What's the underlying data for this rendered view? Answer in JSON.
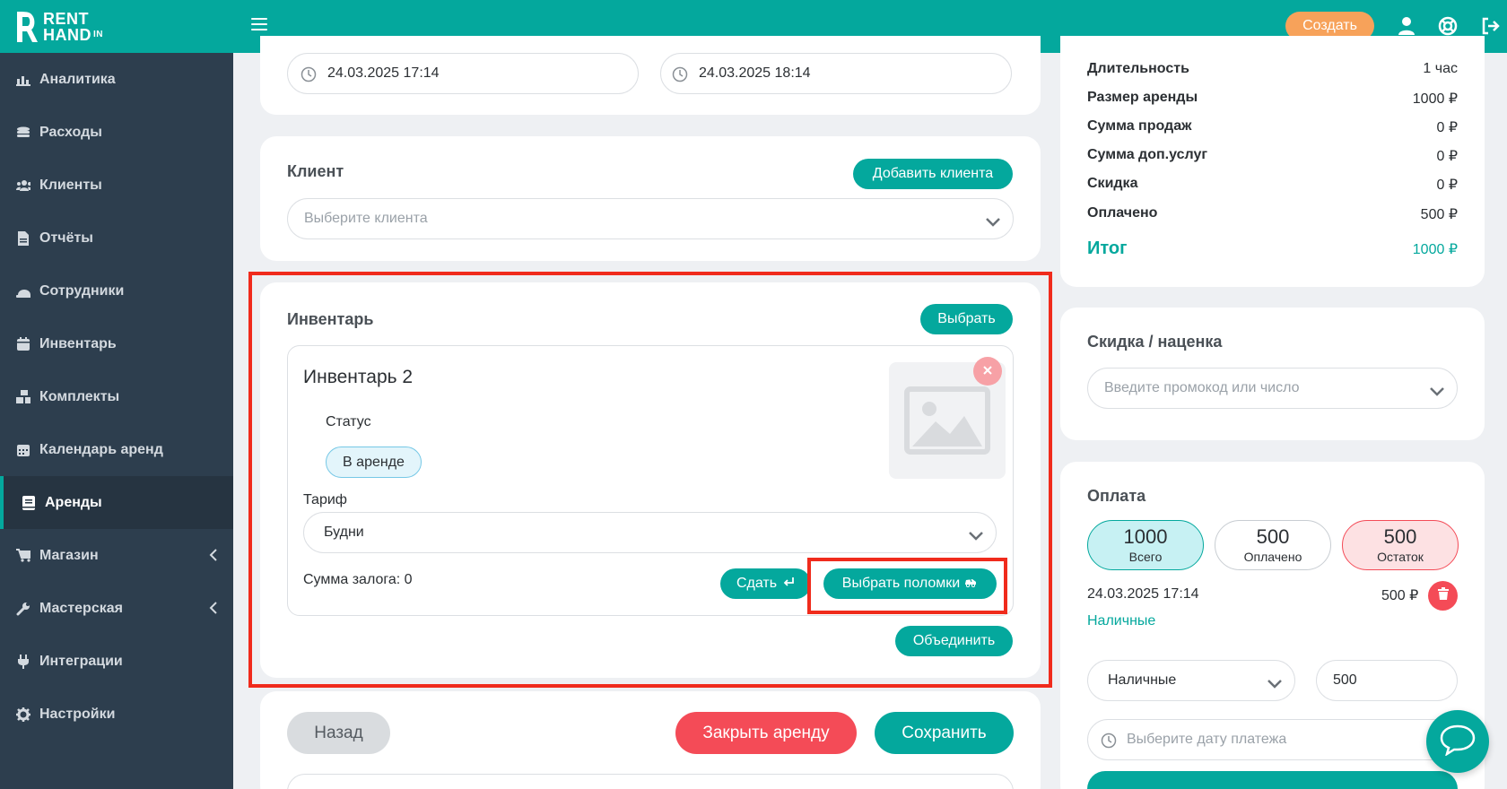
{
  "brand": {
    "line1": "RENT",
    "line2": "HAND",
    "sup": "IN"
  },
  "topbar": {
    "create_label": "Создать"
  },
  "sidebar": {
    "items": [
      {
        "label": "Аналитика",
        "icon": "chart-icon"
      },
      {
        "label": "Расходы",
        "icon": "coins-icon"
      },
      {
        "label": "Клиенты",
        "icon": "users-icon"
      },
      {
        "label": "Отчёты",
        "icon": "file-icon"
      },
      {
        "label": "Сотрудники",
        "icon": "hardhat-icon"
      },
      {
        "label": "Инвентарь",
        "icon": "calendar-icon"
      },
      {
        "label": "Комплекты",
        "icon": "boxes-icon"
      },
      {
        "label": "Календарь аренд",
        "icon": "calendar-grid-icon"
      },
      {
        "label": "Аренды",
        "icon": "book-icon",
        "active": true
      },
      {
        "label": "Магазин",
        "icon": "cart-icon"
      },
      {
        "label": "Мастерская",
        "icon": "wrench-icon"
      },
      {
        "label": "Интеграции",
        "icon": "plug-icon"
      },
      {
        "label": "Настройки",
        "icon": "gear-icon"
      }
    ]
  },
  "dates": {
    "start": "24.03.2025 17:14",
    "end": "24.03.2025 18:14"
  },
  "client": {
    "title": "Клиент",
    "add_label": "Добавить клиента",
    "select_placeholder": "Выберите клиента"
  },
  "inventory": {
    "title": "Инвентарь",
    "choose_label": "Выбрать",
    "item": {
      "name": "Инвентарь 2",
      "status_label": "Статус",
      "status_value": "В аренде",
      "tariff_label": "Тариф",
      "tariff_value": "Будни",
      "deposit": "Сумма залога: 0",
      "return_label": "Сдать",
      "breakage_label": "Выбрать поломки"
    },
    "merge_label": "Объединить"
  },
  "actions": {
    "back": "Назад",
    "close_rent": "Закрыть аренду",
    "save": "Сохранить"
  },
  "summary": {
    "rows": [
      {
        "k": "Длительность",
        "v": "1 час"
      },
      {
        "k": "Размер аренды",
        "v": "1000 ₽"
      },
      {
        "k": "Сумма продаж",
        "v": "0 ₽"
      },
      {
        "k": "Сумма доп.услуг",
        "v": "0 ₽"
      },
      {
        "k": "Скидка",
        "v": "0 ₽"
      },
      {
        "k": "Оплачено",
        "v": "500 ₽"
      }
    ],
    "total_label": "Итог",
    "total_value": "1000 ₽"
  },
  "discount": {
    "title": "Скидка / наценка",
    "placeholder": "Введите промокод или число"
  },
  "payment": {
    "title": "Оплата",
    "total": {
      "value": "1000",
      "label": "Всего"
    },
    "paid": {
      "value": "500",
      "label": "Оплачено"
    },
    "rest": {
      "value": "500",
      "label": "Остаток"
    },
    "entry_date": "24.03.2025 17:14",
    "entry_amount": "500 ₽",
    "entry_method": "Наличные",
    "method_select": "Наличные",
    "amount_input": "500",
    "date_placeholder": "Выберите дату платежа"
  },
  "colors": {
    "accent": "#04a89d",
    "sidebar": "#2d3e4e",
    "danger": "#f44b57",
    "orange": "#f7a25a",
    "highlight": "#f02b1c"
  }
}
